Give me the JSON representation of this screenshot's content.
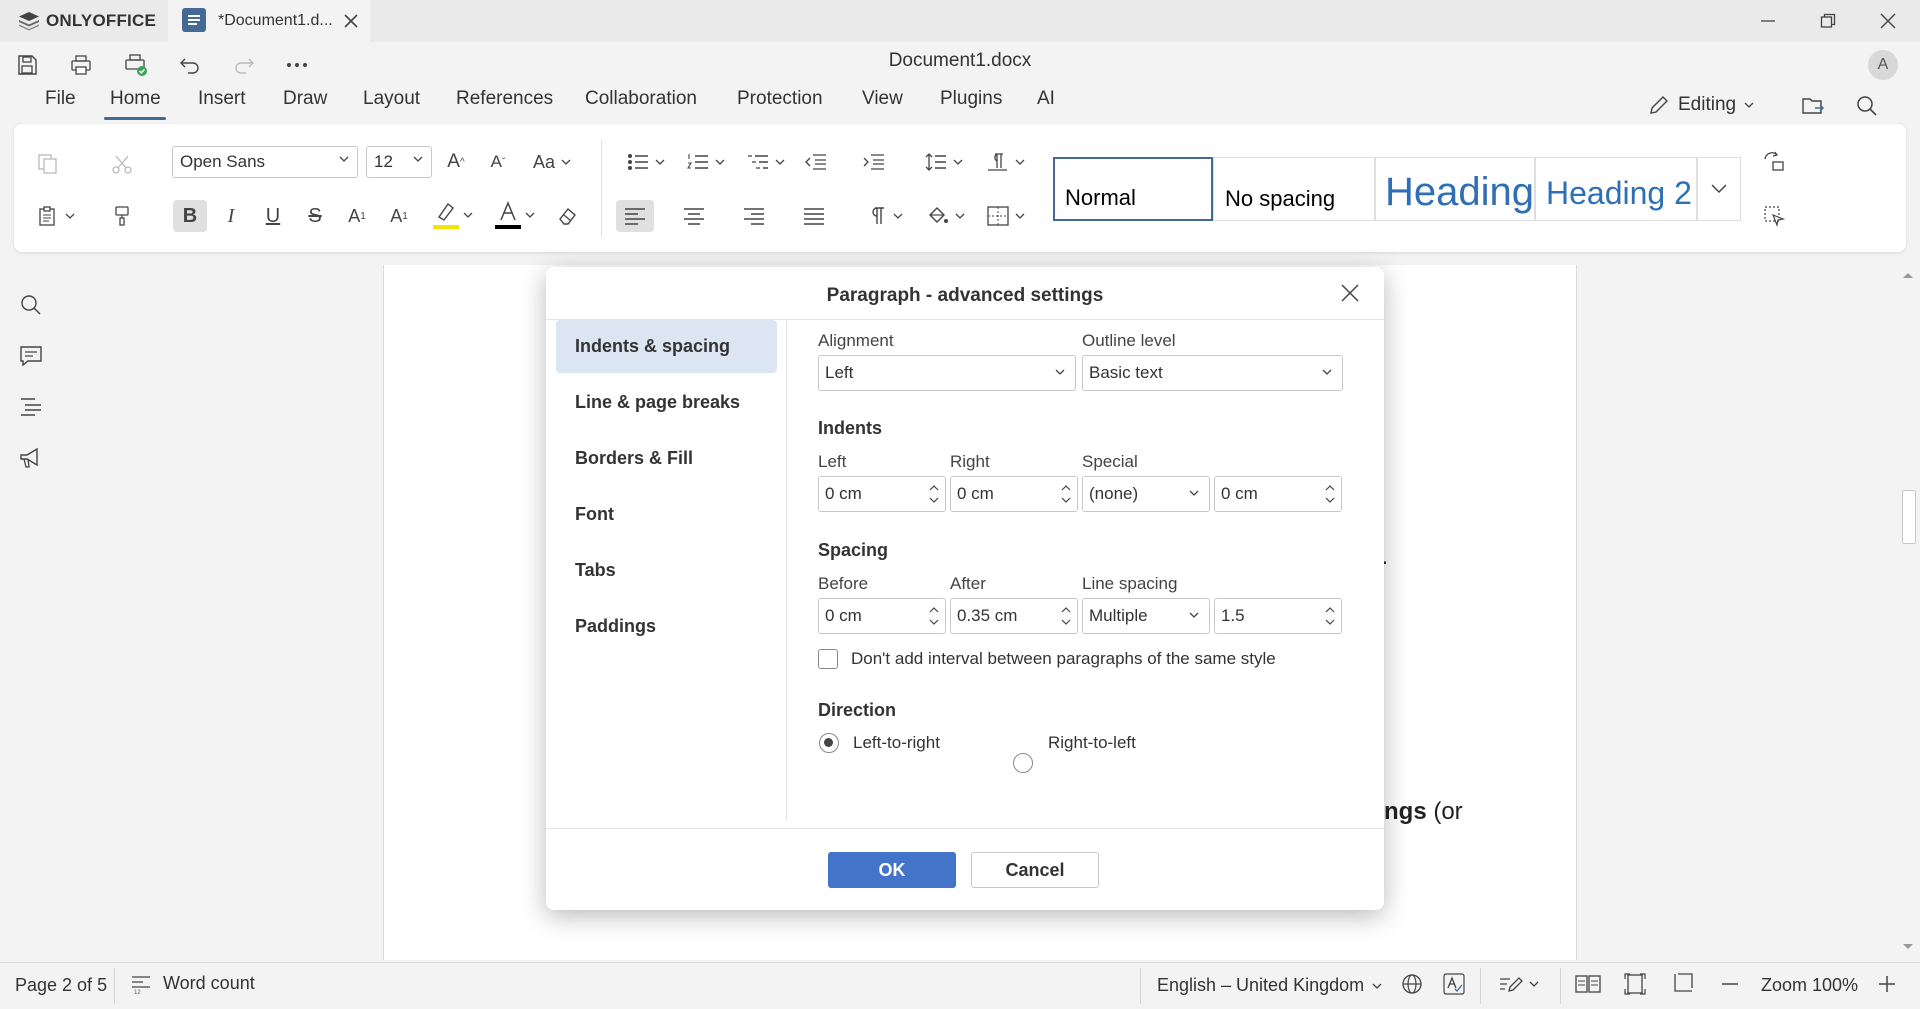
{
  "app": {
    "logo_text": "ONLYOFFICE"
  },
  "tab": {
    "title": "*Document1.d..."
  },
  "document_title": "Document1.docx",
  "user": {
    "avatar_letter": "A"
  },
  "menu": {
    "tabs": [
      "File",
      "Home",
      "Insert",
      "Draw",
      "Layout",
      "References",
      "Collaboration",
      "Protection",
      "View",
      "Plugins",
      "AI"
    ],
    "active": "Home"
  },
  "mode": {
    "label": "Editing"
  },
  "toolbar": {
    "font_name": "Open Sans",
    "font_size": "12",
    "styles": [
      "Normal",
      "No spacing",
      "Heading",
      "Heading 2"
    ],
    "highlight_color": "#f2e600",
    "font_color": "#000000"
  },
  "page": {
    "fragment_1": "e.",
    "fragment_2_bold": "ngs",
    "fragment_2_rest": " (or"
  },
  "dialog": {
    "title": "Paragraph - advanced settings",
    "sidebar": [
      "Indents & spacing",
      "Line & page breaks",
      "Borders & Fill",
      "Font",
      "Tabs",
      "Paddings"
    ],
    "active_item": "Indents & spacing",
    "alignment": {
      "label": "Alignment",
      "value": "Left"
    },
    "outline": {
      "label": "Outline level",
      "value": "Basic text"
    },
    "indents": {
      "heading": "Indents",
      "left": {
        "label": "Left",
        "value": "0 cm"
      },
      "right": {
        "label": "Right",
        "value": "0 cm"
      },
      "special": {
        "label": "Special",
        "value": "(none)",
        "by": "0 cm"
      }
    },
    "spacing": {
      "heading": "Spacing",
      "before": {
        "label": "Before",
        "value": "0 cm"
      },
      "after": {
        "label": "After",
        "value": "0.35 cm"
      },
      "line": {
        "label": "Line spacing",
        "value": "Multiple",
        "amount": "1.5"
      }
    },
    "no_interval": {
      "label": "Don't add interval between paragraphs of the same style",
      "checked": false
    },
    "direction": {
      "heading": "Direction",
      "ltr": "Left-to-right",
      "rtl": "Right-to-left",
      "selected": "ltr"
    },
    "ok": "OK",
    "cancel": "Cancel"
  },
  "status": {
    "page": "Page 2 of 5",
    "word_count": "Word count",
    "language": "English – United Kingdom",
    "zoom": "Zoom 100%"
  }
}
